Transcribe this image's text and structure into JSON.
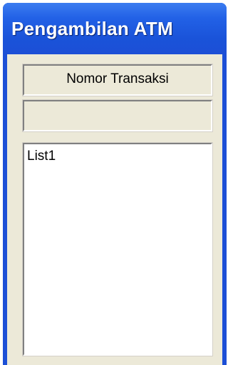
{
  "window": {
    "title": "Pengambilan ATM"
  },
  "form": {
    "transaction_label": "Nomor Transaksi",
    "transaction_value": "",
    "list_items": [
      "List1"
    ]
  },
  "colors": {
    "titlebar": "#1c4fd6",
    "client_bg": "#ece9d8",
    "list_bg": "#ffffff"
  }
}
